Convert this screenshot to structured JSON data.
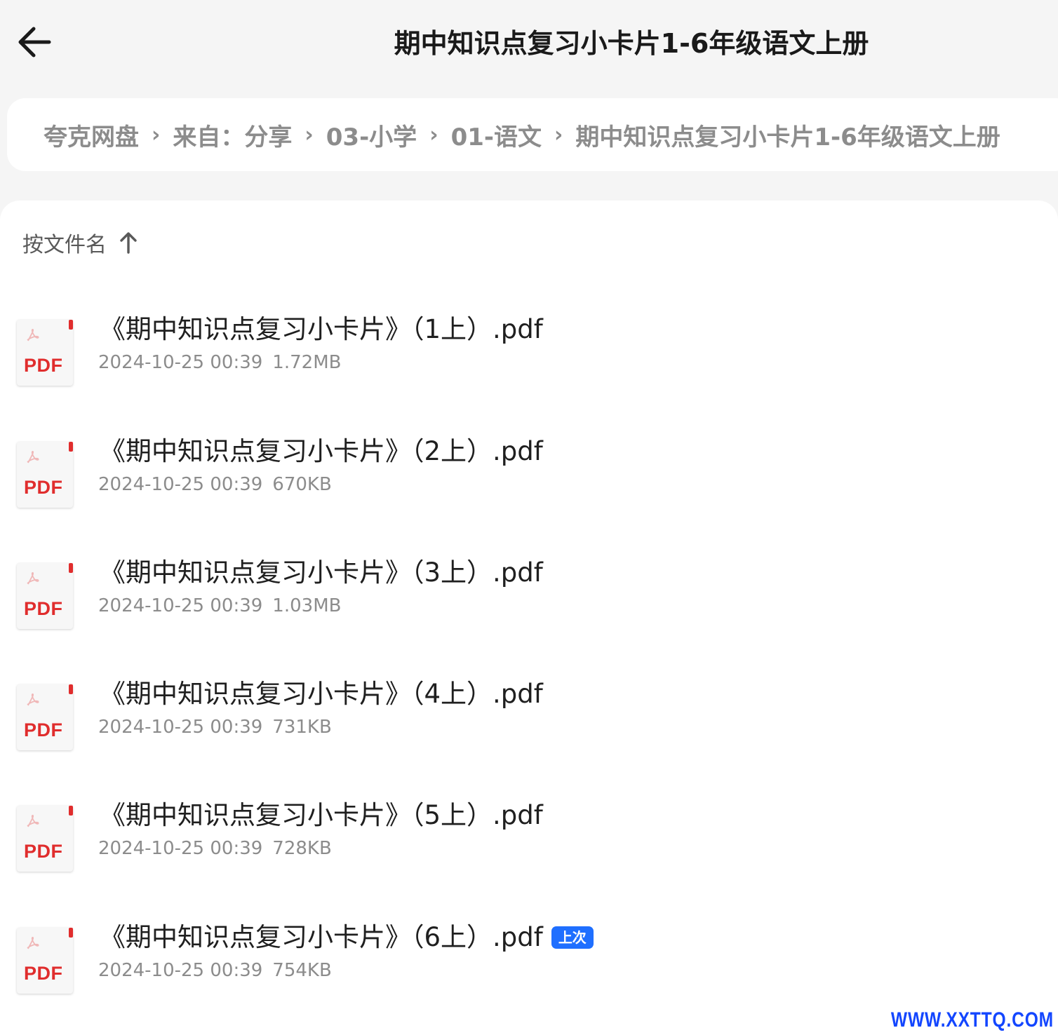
{
  "header": {
    "title": "期中知识点复习小卡片1-6年级语文上册"
  },
  "breadcrumb": {
    "items": [
      "夸克网盘",
      "来自：分享",
      "03-小学",
      "01-语文",
      "期中知识点复习小卡片1-6年级语文上册"
    ],
    "separator": "›"
  },
  "sort": {
    "label": "按文件名",
    "direction_icon": "arrow-up-icon"
  },
  "files": [
    {
      "name": "《期中知识点复习小卡片》（1上）.pdf",
      "date": "2024-10-25 00:39",
      "size": "1.72MB",
      "badge": ""
    },
    {
      "name": "《期中知识点复习小卡片》（2上）.pdf",
      "date": "2024-10-25 00:39",
      "size": "670KB",
      "badge": ""
    },
    {
      "name": "《期中知识点复习小卡片》（3上）.pdf",
      "date": "2024-10-25 00:39",
      "size": "1.03MB",
      "badge": ""
    },
    {
      "name": "《期中知识点复习小卡片》（4上）.pdf",
      "date": "2024-10-25 00:39",
      "size": "731KB",
      "badge": ""
    },
    {
      "name": "《期中知识点复习小卡片》（5上）.pdf",
      "date": "2024-10-25 00:39",
      "size": "728KB",
      "badge": ""
    },
    {
      "name": "《期中知识点复习小卡片》（6上）.pdf",
      "date": "2024-10-25 00:39",
      "size": "754KB",
      "badge": "上次"
    }
  ],
  "file_icon_label": "PDF",
  "watermark": "WWW.XXTTQ.COM",
  "colors": {
    "pdf_red": "#e02d2d",
    "badge_blue": "#1f6fff",
    "watermark_blue": "#1346ff"
  }
}
